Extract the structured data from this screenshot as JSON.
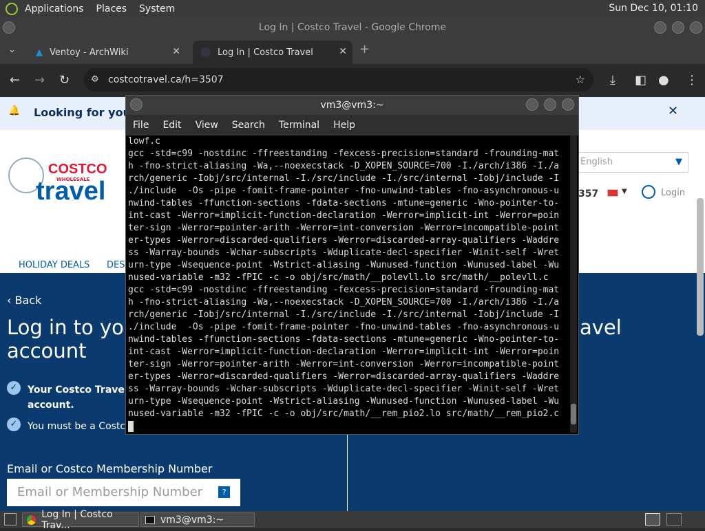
{
  "top_panel": {
    "menus": [
      "Applications",
      "Places",
      "System"
    ],
    "clock": "Sun Dec 10, 01:10"
  },
  "chrome": {
    "title": "Log In | Costco Travel - Google Chrome",
    "tabs": [
      {
        "label": "Ventoy - ArchWiki"
      },
      {
        "label": "Log In | Costco Travel"
      }
    ],
    "url": "costcotravel.ca/h=3507"
  },
  "page": {
    "banner_text": "Looking for your D",
    "language": "English",
    "phone_fragment": "357",
    "login_label": "Login",
    "logo_top": "COSTCO",
    "logo_sub": "WHOLESALE",
    "logo_bottom": "travel",
    "nav": [
      "HOLIDAY DEALS",
      "DEST"
    ],
    "back_label": "Back",
    "heading_line1": "Log in to your",
    "heading_line2": "account",
    "heading_right": "avel",
    "info1": "Your Costco Travel acc",
    "info1b": "account.",
    "info2": "You must be a Costco m",
    "email_label": "Email or Costco Membership Number",
    "email_placeholder": "Email or Membership Number",
    "help_icon_label": "?"
  },
  "terminal": {
    "title": "vm3@vm3:~",
    "menu": [
      "File",
      "Edit",
      "View",
      "Search",
      "Terminal",
      "Help"
    ],
    "lines": [
      "lowf.c",
      "gcc -std=c99 -nostdinc -ffreestanding -fexcess-precision=standard -frounding-mat",
      "h -fno-strict-aliasing -Wa,--noexecstack -D_XOPEN_SOURCE=700 -I./arch/i386 -I./a",
      "rch/generic -Iobj/src/internal -I./src/include -I./src/internal -Iobj/include -I",
      "./include  -Os -pipe -fomit-frame-pointer -fno-unwind-tables -fno-asynchronous-u",
      "nwind-tables -ffunction-sections -fdata-sections -mtune=generic -Wno-pointer-to-",
      "int-cast -Werror=implicit-function-declaration -Werror=implicit-int -Werror=poin",
      "ter-sign -Werror=pointer-arith -Werror=int-conversion -Werror=incompatible-point",
      "er-types -Werror=discarded-qualifiers -Werror=discarded-array-qualifiers -Waddre",
      "ss -Warray-bounds -Wchar-subscripts -Wduplicate-decl-specifier -Winit-self -Wret",
      "urn-type -Wsequence-point -Wstrict-aliasing -Wunused-function -Wunused-label -Wu",
      "nused-variable -m32 -fPIC -c -o obj/src/math/__polevll.lo src/math/__polevll.c",
      "gcc -std=c99 -nostdinc -ffreestanding -fexcess-precision=standard -frounding-mat",
      "h -fno-strict-aliasing -Wa,--noexecstack -D_XOPEN_SOURCE=700 -I./arch/i386 -I./a",
      "rch/generic -Iobj/src/internal -I./src/include -I./src/internal -Iobj/include -I",
      "./include  -Os -pipe -fomit-frame-pointer -fno-unwind-tables -fno-asynchronous-u",
      "nwind-tables -ffunction-sections -fdata-sections -mtune=generic -Wno-pointer-to-",
      "int-cast -Werror=implicit-function-declaration -Werror=implicit-int -Werror=poin",
      "ter-sign -Werror=pointer-arith -Werror=int-conversion -Werror=incompatible-point",
      "er-types -Werror=discarded-qualifiers -Werror=discarded-array-qualifiers -Waddre",
      "ss -Warray-bounds -Wchar-subscripts -Wduplicate-decl-specifier -Winit-self -Wret",
      "urn-type -Wsequence-point -Wstrict-aliasing -Wunused-function -Wunused-label -Wu",
      "nused-variable -m32 -fPIC -c -o obj/src/math/__rem_pio2.lo src/math/__rem_pio2.c"
    ]
  },
  "taskbar": {
    "tasks": [
      {
        "label": "Log In | Costco Trav..."
      },
      {
        "label": "vm3@vm3:~"
      }
    ]
  },
  "colors": {
    "hero_blue": "#0b3a6f",
    "costco_red": "#e31837",
    "costco_blue": "#005daa"
  }
}
